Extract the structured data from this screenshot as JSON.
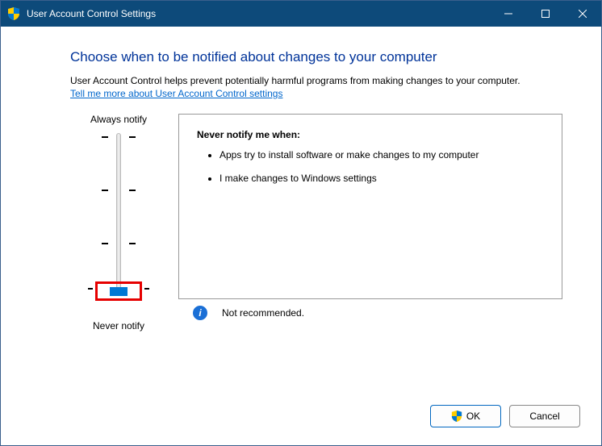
{
  "titlebar": {
    "title": "User Account Control Settings"
  },
  "content": {
    "heading": "Choose when to be notified about changes to your computer",
    "subtext": "User Account Control helps prevent potentially harmful programs from making changes to your computer.",
    "link": "Tell me more about User Account Control settings"
  },
  "slider": {
    "top_label": "Always notify",
    "bottom_label": "Never notify"
  },
  "description": {
    "title": "Never notify me when:",
    "items": [
      "Apps try to install software or make changes to my computer",
      "I make changes to Windows settings"
    ],
    "recommendation": "Not recommended."
  },
  "footer": {
    "ok": "OK",
    "cancel": "Cancel"
  }
}
